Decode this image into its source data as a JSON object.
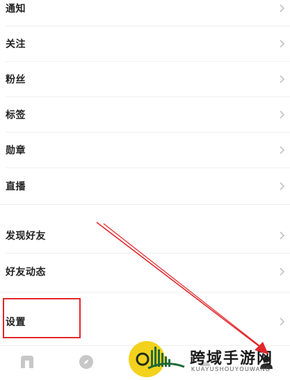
{
  "menu": {
    "group1": [
      {
        "label": "通知"
      },
      {
        "label": "关注"
      },
      {
        "label": "粉丝"
      },
      {
        "label": "标签"
      },
      {
        "label": "勋章"
      },
      {
        "label": "直播"
      }
    ],
    "group2": [
      {
        "label": "发现好友"
      },
      {
        "label": "好友动态"
      }
    ],
    "settings": {
      "label": "设置"
    }
  },
  "tabbar": {
    "icons": [
      "home-n-icon",
      "compass-icon",
      "activity-icon",
      "profile-icon"
    ]
  },
  "watermark": {
    "title": "跨域手游网",
    "subtitle": "KUAYUSHOUYOUWANG"
  },
  "annotation_color": "#e3262b"
}
